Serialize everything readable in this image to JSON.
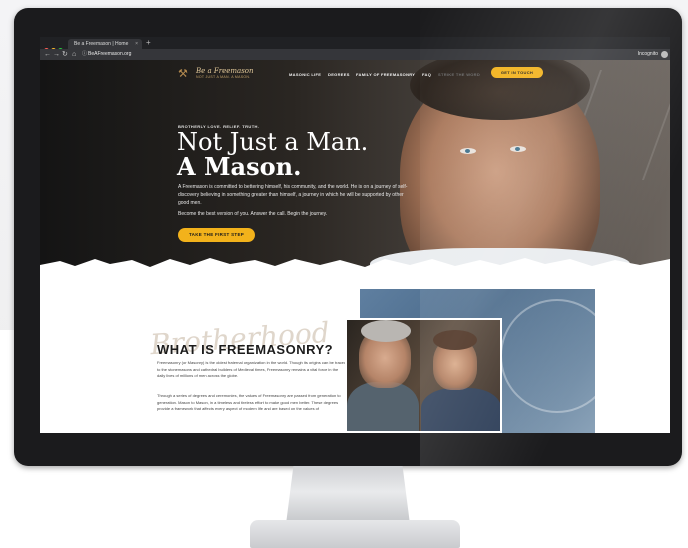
{
  "browser": {
    "tab_title": "Be a Freemason | Home",
    "tab_close": "×",
    "new_tab": "+",
    "url": "BeAFreemason.org",
    "mode_label": "Incognito"
  },
  "site": {
    "logo_text": "Be a Freemason",
    "logo_tagline": "NOT JUST A MAN. A MASON.",
    "nav": [
      "MASONIC LIFE",
      "DEGREES",
      "FAMILY OF FREEMASONRY",
      "FAQ",
      "STRIKE THE WORD"
    ],
    "cta_touch": "GET IN TOUCH"
  },
  "hero": {
    "eyebrow": "BROTHERLY LOVE. RELIEF. TRUTH.",
    "title_line1": "Not Just a Man.",
    "title_line2": "A Mason.",
    "body1": "A Freemason is committed to bettering himself, his community, and the world. He is on a journey of self-discovery believing in something greater than himself, a journey in which he will be supported by other good men.",
    "body2": "Become the best version of you. Answer the call. Begin the journey.",
    "cta": "TAKE THE FIRST STEP"
  },
  "about": {
    "script": "Brotherhood",
    "heading": "WHAT IS FREEMASONRY?",
    "para1": "Freemasonry (or Masonry) is the oldest fraternal organization in the world. Though its origins can be traced to the stonemasons and cathedral builders of Medieval times, Freemasonry remains a vital force in the daily lives of millions of men across the globe.",
    "para2": "Through a series of degrees and ceremonies, the values of Freemasonry are passed from generation to generation. Mason to Mason, in a timeless and tireless effort to make good men better. These degrees provide a framework that affects every aspect of modern life and are based on the values of"
  },
  "colors": {
    "accent": "#f2b21b",
    "hero_dark": "#141414",
    "chrome": "#202124"
  }
}
